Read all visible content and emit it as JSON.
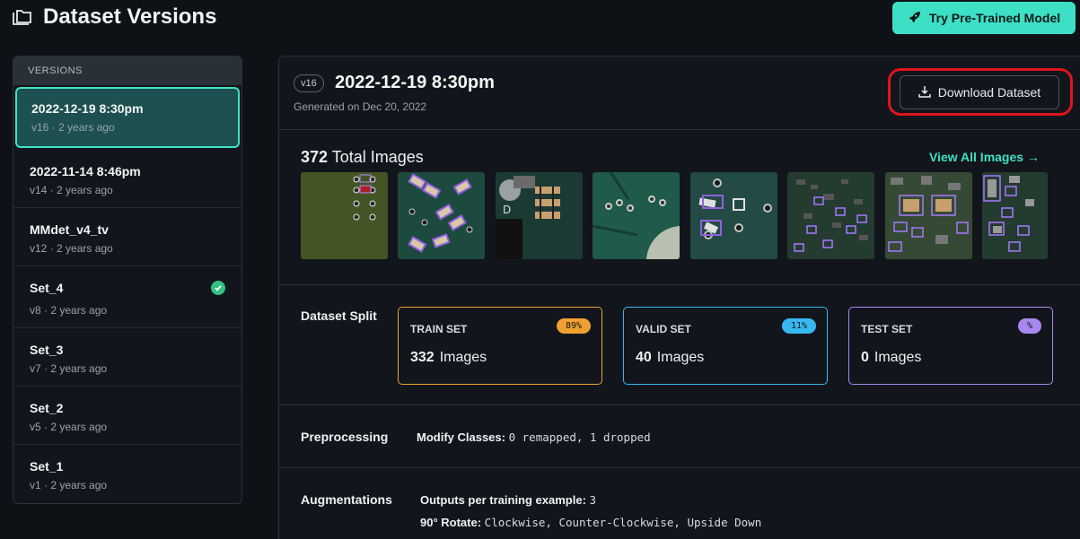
{
  "page": {
    "title": "Dataset Versions",
    "try_button": "Try Pre-Trained Model"
  },
  "sidebar": {
    "header": "VERSIONS",
    "items": [
      {
        "name": "2022-12-19 8:30pm",
        "sub": "v16 · 2 years ago",
        "active": true,
        "checked": false
      },
      {
        "name": "2022-11-14 8:46pm",
        "sub": "v14 · 2 years ago",
        "active": false,
        "checked": false
      },
      {
        "name": "MMdet_v4_tv",
        "sub": "v12 · 2 years ago",
        "active": false,
        "checked": false
      },
      {
        "name": "Set_4",
        "sub": "v8 · 2 years ago",
        "active": false,
        "checked": true
      },
      {
        "name": "Set_3",
        "sub": "v7 · 2 years ago",
        "active": false,
        "checked": false
      },
      {
        "name": "Set_2",
        "sub": "v5 · 2 years ago",
        "active": false,
        "checked": false
      },
      {
        "name": "Set_1",
        "sub": "v1 · 2 years ago",
        "active": false,
        "checked": false
      }
    ]
  },
  "version": {
    "badge": "v16",
    "title": "2022-12-19 8:30pm",
    "generated": "Generated on Dec 20, 2022",
    "download_button": "Download Dataset"
  },
  "images": {
    "count": "372",
    "label": "Total Images",
    "view_all": "View All Images →"
  },
  "split": {
    "label": "Dataset Split",
    "cards": [
      {
        "label": "TRAIN SET",
        "percent": "89%",
        "count": "332",
        "unit": "Images",
        "color": "#f0a030"
      },
      {
        "label": "VALID SET",
        "percent": "11%",
        "count": "40",
        "unit": "Images",
        "color": "#38b8f0"
      },
      {
        "label": "TEST SET",
        "percent": "%",
        "count": "0",
        "unit": "Images",
        "color": "#a888f0"
      }
    ]
  },
  "preprocessing": {
    "label": "Preprocessing",
    "key": "Modify Classes:",
    "value": "0 remapped, 1 dropped"
  },
  "augmentations": {
    "label": "Augmentations",
    "outputs_key": "Outputs per training example:",
    "outputs_value": "3",
    "rotate_key": "90° Rotate:",
    "rotate_value": "Clockwise, Counter-Clockwise, Upside Down"
  }
}
